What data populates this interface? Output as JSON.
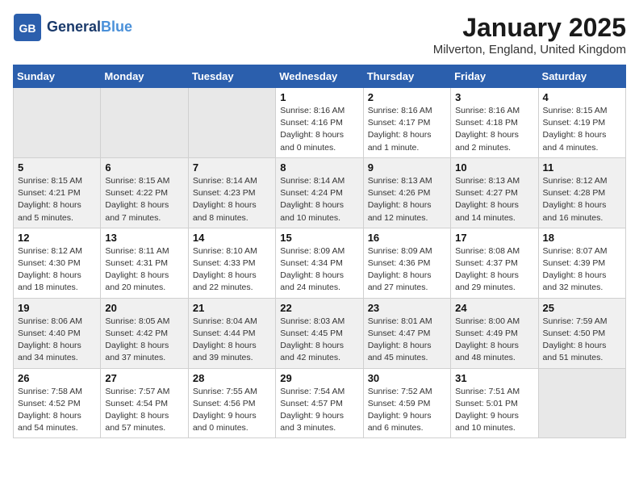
{
  "header": {
    "logo_general": "General",
    "logo_blue": "Blue",
    "month": "January 2025",
    "location": "Milverton, England, United Kingdom"
  },
  "weekdays": [
    "Sunday",
    "Monday",
    "Tuesday",
    "Wednesday",
    "Thursday",
    "Friday",
    "Saturday"
  ],
  "rows": [
    [
      {
        "day": "",
        "sunrise": "",
        "sunset": "",
        "daylight": ""
      },
      {
        "day": "",
        "sunrise": "",
        "sunset": "",
        "daylight": ""
      },
      {
        "day": "",
        "sunrise": "",
        "sunset": "",
        "daylight": ""
      },
      {
        "day": "1",
        "sunrise": "Sunrise: 8:16 AM",
        "sunset": "Sunset: 4:16 PM",
        "daylight": "Daylight: 8 hours and 0 minutes."
      },
      {
        "day": "2",
        "sunrise": "Sunrise: 8:16 AM",
        "sunset": "Sunset: 4:17 PM",
        "daylight": "Daylight: 8 hours and 1 minute."
      },
      {
        "day": "3",
        "sunrise": "Sunrise: 8:16 AM",
        "sunset": "Sunset: 4:18 PM",
        "daylight": "Daylight: 8 hours and 2 minutes."
      },
      {
        "day": "4",
        "sunrise": "Sunrise: 8:15 AM",
        "sunset": "Sunset: 4:19 PM",
        "daylight": "Daylight: 8 hours and 4 minutes."
      }
    ],
    [
      {
        "day": "5",
        "sunrise": "Sunrise: 8:15 AM",
        "sunset": "Sunset: 4:21 PM",
        "daylight": "Daylight: 8 hours and 5 minutes."
      },
      {
        "day": "6",
        "sunrise": "Sunrise: 8:15 AM",
        "sunset": "Sunset: 4:22 PM",
        "daylight": "Daylight: 8 hours and 7 minutes."
      },
      {
        "day": "7",
        "sunrise": "Sunrise: 8:14 AM",
        "sunset": "Sunset: 4:23 PM",
        "daylight": "Daylight: 8 hours and 8 minutes."
      },
      {
        "day": "8",
        "sunrise": "Sunrise: 8:14 AM",
        "sunset": "Sunset: 4:24 PM",
        "daylight": "Daylight: 8 hours and 10 minutes."
      },
      {
        "day": "9",
        "sunrise": "Sunrise: 8:13 AM",
        "sunset": "Sunset: 4:26 PM",
        "daylight": "Daylight: 8 hours and 12 minutes."
      },
      {
        "day": "10",
        "sunrise": "Sunrise: 8:13 AM",
        "sunset": "Sunset: 4:27 PM",
        "daylight": "Daylight: 8 hours and 14 minutes."
      },
      {
        "day": "11",
        "sunrise": "Sunrise: 8:12 AM",
        "sunset": "Sunset: 4:28 PM",
        "daylight": "Daylight: 8 hours and 16 minutes."
      }
    ],
    [
      {
        "day": "12",
        "sunrise": "Sunrise: 8:12 AM",
        "sunset": "Sunset: 4:30 PM",
        "daylight": "Daylight: 8 hours and 18 minutes."
      },
      {
        "day": "13",
        "sunrise": "Sunrise: 8:11 AM",
        "sunset": "Sunset: 4:31 PM",
        "daylight": "Daylight: 8 hours and 20 minutes."
      },
      {
        "day": "14",
        "sunrise": "Sunrise: 8:10 AM",
        "sunset": "Sunset: 4:33 PM",
        "daylight": "Daylight: 8 hours and 22 minutes."
      },
      {
        "day": "15",
        "sunrise": "Sunrise: 8:09 AM",
        "sunset": "Sunset: 4:34 PM",
        "daylight": "Daylight: 8 hours and 24 minutes."
      },
      {
        "day": "16",
        "sunrise": "Sunrise: 8:09 AM",
        "sunset": "Sunset: 4:36 PM",
        "daylight": "Daylight: 8 hours and 27 minutes."
      },
      {
        "day": "17",
        "sunrise": "Sunrise: 8:08 AM",
        "sunset": "Sunset: 4:37 PM",
        "daylight": "Daylight: 8 hours and 29 minutes."
      },
      {
        "day": "18",
        "sunrise": "Sunrise: 8:07 AM",
        "sunset": "Sunset: 4:39 PM",
        "daylight": "Daylight: 8 hours and 32 minutes."
      }
    ],
    [
      {
        "day": "19",
        "sunrise": "Sunrise: 8:06 AM",
        "sunset": "Sunset: 4:40 PM",
        "daylight": "Daylight: 8 hours and 34 minutes."
      },
      {
        "day": "20",
        "sunrise": "Sunrise: 8:05 AM",
        "sunset": "Sunset: 4:42 PM",
        "daylight": "Daylight: 8 hours and 37 minutes."
      },
      {
        "day": "21",
        "sunrise": "Sunrise: 8:04 AM",
        "sunset": "Sunset: 4:44 PM",
        "daylight": "Daylight: 8 hours and 39 minutes."
      },
      {
        "day": "22",
        "sunrise": "Sunrise: 8:03 AM",
        "sunset": "Sunset: 4:45 PM",
        "daylight": "Daylight: 8 hours and 42 minutes."
      },
      {
        "day": "23",
        "sunrise": "Sunrise: 8:01 AM",
        "sunset": "Sunset: 4:47 PM",
        "daylight": "Daylight: 8 hours and 45 minutes."
      },
      {
        "day": "24",
        "sunrise": "Sunrise: 8:00 AM",
        "sunset": "Sunset: 4:49 PM",
        "daylight": "Daylight: 8 hours and 48 minutes."
      },
      {
        "day": "25",
        "sunrise": "Sunrise: 7:59 AM",
        "sunset": "Sunset: 4:50 PM",
        "daylight": "Daylight: 8 hours and 51 minutes."
      }
    ],
    [
      {
        "day": "26",
        "sunrise": "Sunrise: 7:58 AM",
        "sunset": "Sunset: 4:52 PM",
        "daylight": "Daylight: 8 hours and 54 minutes."
      },
      {
        "day": "27",
        "sunrise": "Sunrise: 7:57 AM",
        "sunset": "Sunset: 4:54 PM",
        "daylight": "Daylight: 8 hours and 57 minutes."
      },
      {
        "day": "28",
        "sunrise": "Sunrise: 7:55 AM",
        "sunset": "Sunset: 4:56 PM",
        "daylight": "Daylight: 9 hours and 0 minutes."
      },
      {
        "day": "29",
        "sunrise": "Sunrise: 7:54 AM",
        "sunset": "Sunset: 4:57 PM",
        "daylight": "Daylight: 9 hours and 3 minutes."
      },
      {
        "day": "30",
        "sunrise": "Sunrise: 7:52 AM",
        "sunset": "Sunset: 4:59 PM",
        "daylight": "Daylight: 9 hours and 6 minutes."
      },
      {
        "day": "31",
        "sunrise": "Sunrise: 7:51 AM",
        "sunset": "Sunset: 5:01 PM",
        "daylight": "Daylight: 9 hours and 10 minutes."
      },
      {
        "day": "",
        "sunrise": "",
        "sunset": "",
        "daylight": ""
      }
    ]
  ]
}
